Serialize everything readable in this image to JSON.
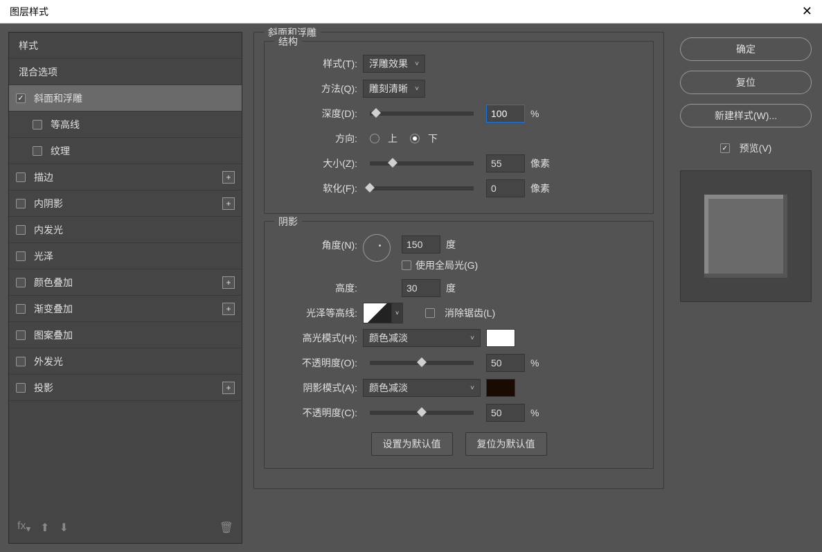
{
  "title": "图层样式",
  "sidebar": {
    "header_styles": "样式",
    "header_blend": "混合选项",
    "items": [
      {
        "label": "斜面和浮雕",
        "checked": true,
        "selected": true,
        "plus": false,
        "sub": false
      },
      {
        "label": "等高线",
        "checked": false,
        "selected": false,
        "plus": false,
        "sub": true
      },
      {
        "label": "纹理",
        "checked": false,
        "selected": false,
        "plus": false,
        "sub": true
      },
      {
        "label": "描边",
        "checked": false,
        "selected": false,
        "plus": true,
        "sub": false
      },
      {
        "label": "内阴影",
        "checked": false,
        "selected": false,
        "plus": true,
        "sub": false
      },
      {
        "label": "内发光",
        "checked": false,
        "selected": false,
        "plus": false,
        "sub": false
      },
      {
        "label": "光泽",
        "checked": false,
        "selected": false,
        "plus": false,
        "sub": false
      },
      {
        "label": "颜色叠加",
        "checked": false,
        "selected": false,
        "plus": true,
        "sub": false
      },
      {
        "label": "渐变叠加",
        "checked": false,
        "selected": false,
        "plus": true,
        "sub": false
      },
      {
        "label": "图案叠加",
        "checked": false,
        "selected": false,
        "plus": false,
        "sub": false
      },
      {
        "label": "外发光",
        "checked": false,
        "selected": false,
        "plus": false,
        "sub": false
      },
      {
        "label": "投影",
        "checked": false,
        "selected": false,
        "plus": true,
        "sub": false
      }
    ]
  },
  "panel": {
    "group_title": "斜面和浮雕",
    "structure_title": "结构",
    "style_label": "样式(T):",
    "style_value": "浮雕效果",
    "technique_label": "方法(Q):",
    "technique_value": "雕刻清晰",
    "depth_label": "深度(D):",
    "depth_value": "100",
    "depth_unit": "%",
    "direction_label": "方向:",
    "dir_up": "上",
    "dir_down": "下",
    "size_label": "大小(Z):",
    "size_value": "55",
    "size_unit": "像素",
    "soften_label": "软化(F):",
    "soften_value": "0",
    "soften_unit": "像素",
    "shading_title": "阴影",
    "angle_label": "角度(N):",
    "angle_value": "150",
    "angle_unit": "度",
    "global_label": "使用全局光(G)",
    "altitude_label": "高度:",
    "altitude_value": "30",
    "altitude_unit": "度",
    "gloss_label": "光泽等高线:",
    "antialias_label": "消除锯齿(L)",
    "highlight_label": "高光模式(H):",
    "highlight_value": "颜色减淡",
    "hi_opacity_label": "不透明度(O):",
    "hi_opacity_value": "50",
    "hi_opacity_unit": "%",
    "shadow_label": "阴影模式(A):",
    "shadow_value": "颜色减淡",
    "sh_opacity_label": "不透明度(C):",
    "sh_opacity_value": "50",
    "sh_opacity_unit": "%",
    "btn_default": "设置为默认值",
    "btn_reset": "复位为默认值"
  },
  "right": {
    "ok": "确定",
    "cancel": "复位",
    "new_style": "新建样式(W)...",
    "preview": "预览(V)"
  }
}
